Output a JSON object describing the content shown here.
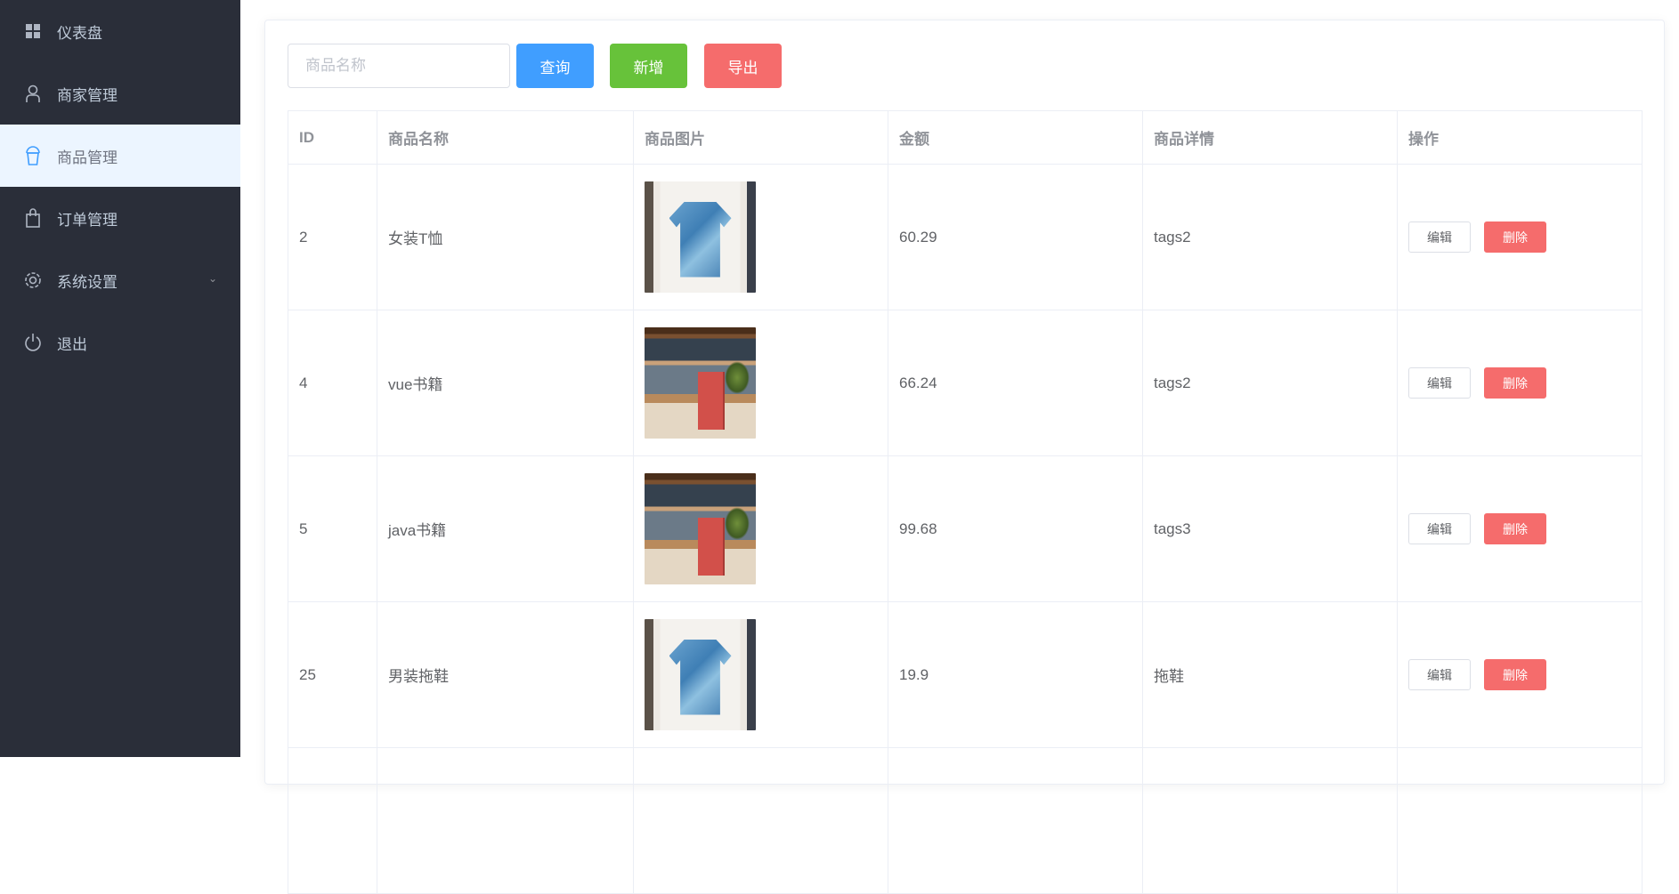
{
  "sidebar": {
    "items": [
      {
        "label": "仪表盘",
        "icon": "dashboard-icon"
      },
      {
        "label": "商家管理",
        "icon": "user-icon"
      },
      {
        "label": "商品管理",
        "icon": "goods-icon",
        "active": true
      },
      {
        "label": "订单管理",
        "icon": "shopping-bag-icon"
      },
      {
        "label": "系统设置",
        "icon": "gear-icon"
      },
      {
        "label": "退出",
        "icon": "power-icon"
      }
    ]
  },
  "toolbar": {
    "search_placeholder": "商品名称",
    "search_value": "",
    "query_label": "查询",
    "add_label": "新增",
    "export_label": "导出"
  },
  "table": {
    "columns": [
      "ID",
      "商品名称",
      "商品图片",
      "金额",
      "商品详情",
      "操作"
    ],
    "edit_label": "编辑",
    "delete_label": "删除",
    "rows": [
      {
        "id": "2",
        "name": "女装T恤",
        "image": "tshirt",
        "amount": "60.29",
        "detail": "tags2"
      },
      {
        "id": "4",
        "name": "vue书籍",
        "image": "books",
        "amount": "66.24",
        "detail": "tags2"
      },
      {
        "id": "5",
        "name": "java书籍",
        "image": "books",
        "amount": "99.68",
        "detail": "tags3"
      },
      {
        "id": "25",
        "name": "男装拖鞋",
        "image": "tshirt",
        "amount": "19.9",
        "detail": "拖鞋"
      }
    ]
  },
  "colors": {
    "sidebar": "#2a2e39",
    "primary": "#409eff",
    "success": "#67c23a",
    "danger": "#f56c6c",
    "active_bg": "#ecf5ff"
  }
}
